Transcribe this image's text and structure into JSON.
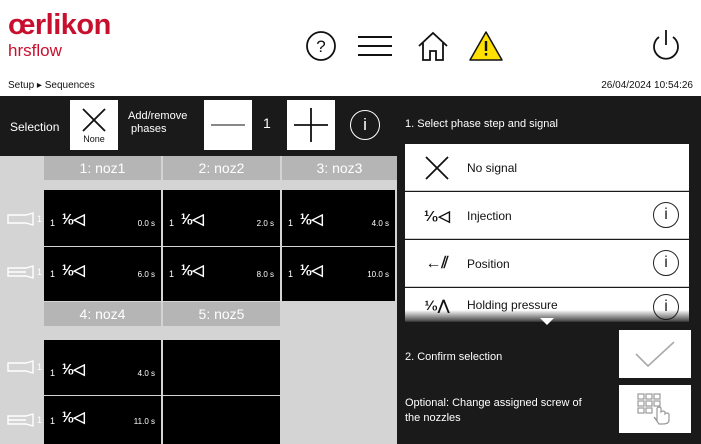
{
  "header": {
    "brand": "œrlikon",
    "brand_sub": "hrsflow",
    "breadcrumb": "Setup ▸ Sequences",
    "datetime": "26/04/2024 10:54:26",
    "icons": [
      "help-icon",
      "menu-icon",
      "home-icon",
      "warning-icon",
      "power-icon"
    ],
    "warning_color": "#ffe000",
    "brand_color": "#c8102e"
  },
  "selection_bar": {
    "selection_label": "Selection",
    "none_label": "None",
    "add_remove_label_1": "Add/remove",
    "add_remove_label_2": "phases",
    "phase_count": "1",
    "minus_icon": "minus-icon",
    "plus_icon": "plus-icon",
    "info_icon": "info-icon"
  },
  "grid": {
    "group1": {
      "columns": [
        "1: noz1",
        "2: noz2",
        "3: noz3"
      ],
      "rows": [
        {
          "row_label": "1",
          "cells": [
            {
              "index": "1",
              "phase": "¹⁄₀◁",
              "time": "0.0 s"
            },
            {
              "index": "1",
              "phase": "¹⁄₀◁",
              "time": "2.0 s"
            },
            {
              "index": "1",
              "phase": "¹⁄₀◁",
              "time": "4.0 s"
            }
          ]
        },
        {
          "row_label": "1",
          "cells": [
            {
              "index": "1",
              "phase": "¹⁄₀◁",
              "time": "6.0 s"
            },
            {
              "index": "1",
              "phase": "¹⁄₀◁",
              "time": "8.0 s"
            },
            {
              "index": "1",
              "phase": "¹⁄₀◁",
              "time": "10.0 s"
            }
          ]
        }
      ]
    },
    "group2": {
      "columns": [
        "4: noz4",
        "5: noz5"
      ],
      "rows": [
        {
          "row_label": "1",
          "cells": [
            {
              "index": "1",
              "phase": "¹⁄₀◁",
              "time": "4.0 s"
            },
            {
              "index": "",
              "phase": "",
              "time": ""
            }
          ]
        },
        {
          "row_label": "1",
          "cells": [
            {
              "index": "1",
              "phase": "¹⁄₀◁",
              "time": "11.0 s"
            },
            {
              "index": "",
              "phase": "",
              "time": ""
            }
          ]
        }
      ]
    }
  },
  "right_panel": {
    "step1_title": "1. Select phase step and signal",
    "options": [
      {
        "label": "No signal",
        "icon": "x-icon",
        "has_info": false
      },
      {
        "label": "Injection",
        "icon": "injection-icon",
        "has_info": true
      },
      {
        "label": "Position",
        "icon": "position-icon",
        "has_info": true
      },
      {
        "label": "Holding pressure",
        "icon": "holding-pressure-icon",
        "has_info": true
      }
    ],
    "step2_title": "2. Confirm selection",
    "optional_line1": "Optional: Change assigned screw of",
    "optional_line2": "the nozzles"
  }
}
